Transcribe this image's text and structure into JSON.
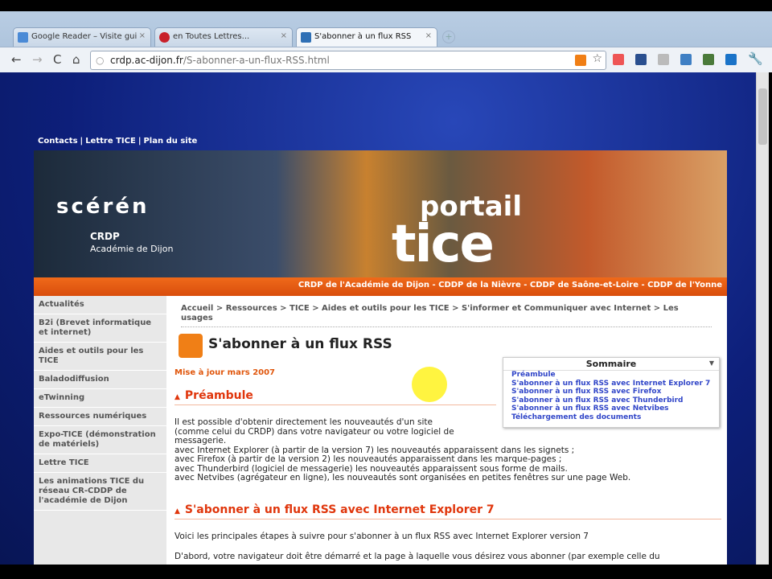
{
  "browser": {
    "tabs": [
      {
        "label": "Google Reader – Visite gui",
        "color": "#4a8ad6"
      },
      {
        "label": "en Toutes Lettres...",
        "color": "#c8202a"
      },
      {
        "label": "S'abonner à un flux RSS",
        "color": "#2e6fb5"
      }
    ],
    "url_host": "crdp.ac-dijon.fr",
    "url_path": "/S-abonner-a-un-flux-RSS.html"
  },
  "site": {
    "toplinks": [
      "Contacts",
      "|",
      "Lettre TICE",
      "|",
      "Plan du site"
    ],
    "logo": {
      "sceren": "scérén",
      "crdp": "CRDP",
      "academie": "Académie de Dijon",
      "portail": "portail",
      "tice": "tice"
    },
    "orange_bar": "CRDP de l'Académie de Dijon - CDDP de la Nièvre - CDDP de Saône-et-Loire - CDDP de l'Yonne",
    "sidebar": [
      "Actualités",
      "B2i (Brevet informatique et internet)",
      "Aides et outils pour les TICE",
      "Baladodiffusion",
      "eTwinning",
      "Ressources numériques",
      "Expo-TICE (démonstration de matériels)",
      "Lettre TICE",
      "Les animations TICE du réseau CR-CDDP de l'académie de Dijon"
    ],
    "breadcrumb": "Accueil > Ressources > TICE > Aides et outils pour les TICE > S'informer et Communiquer avec Internet > Les usages",
    "title": "S'abonner à un flux RSS",
    "updated": "Mise à jour mars 2007",
    "sommaire": {
      "title": "Sommaire",
      "items": [
        "Préambule",
        "S'abonner à un flux RSS avec Internet Explorer 7",
        "S'abonner à un flux RSS avec Firefox",
        "S'abonner à un flux RSS avec Thunderbird",
        "S'abonner à un flux RSS avec Netvibes",
        "Téléchargement des documents"
      ]
    },
    "h_preambule": "Préambule",
    "preambule_lines": [
      "Il est possible d'obtenir directement les nouveautés d'un site",
      "(comme celui du CRDP) dans votre navigateur ou votre logiciel de",
      "messagerie.",
      "avec Internet Explorer (à partir de la version 7) les nouveautés apparaissent dans les signets ;",
      "avec Firefox (à partir de la version 2) les nouveautés apparaissent dans les marque-pages ;",
      "avec Thunderbird (logiciel de messagerie) les nouveautés apparaissent sous forme de mails.",
      "avec Netvibes (agrégateur en ligne), les nouveautés sont organisées en petites fenêtres sur une page Web."
    ],
    "h_ie": "S'abonner à un flux RSS avec Internet Explorer 7",
    "ie_p1": "Voici les principales étapes à suivre pour s'abonner à un flux RSS avec Internet Explorer version 7",
    "ie_p2": "D'abord, votre navigateur doit être démarré et la page à laquelle vous désirez vous abonner (par exemple celle du"
  }
}
